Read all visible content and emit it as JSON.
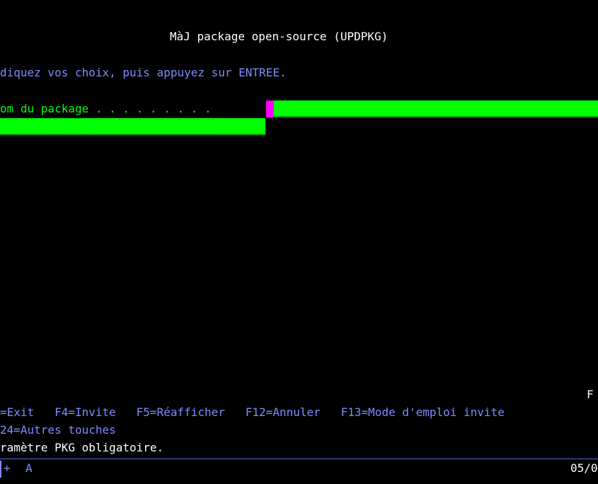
{
  "screen": {
    "title": "MàJ package open-source (UPDPKG)",
    "instruction": "diquez vos choix, puis appuyez sur ENTREE.",
    "field_label": "om du package . . . . . . . . .",
    "top_right_partial": "F",
    "function_keys_row1": "=Exit   F4=Invite   F5=Réafficher   F12=Annuler   F13=Mode d'emploi invite",
    "function_keys_row2": "24=Autres touches",
    "message": "ramètre PKG obligatoire."
  },
  "status": {
    "indicator": "+",
    "mode": "A",
    "right": "05/0"
  },
  "colors": {
    "background": "#000000",
    "title": "#FFFFFF",
    "text": "#7F8CFF",
    "field_label": "#00FF00",
    "input_field": "#00FF00",
    "cursor": "#FF00FF"
  }
}
